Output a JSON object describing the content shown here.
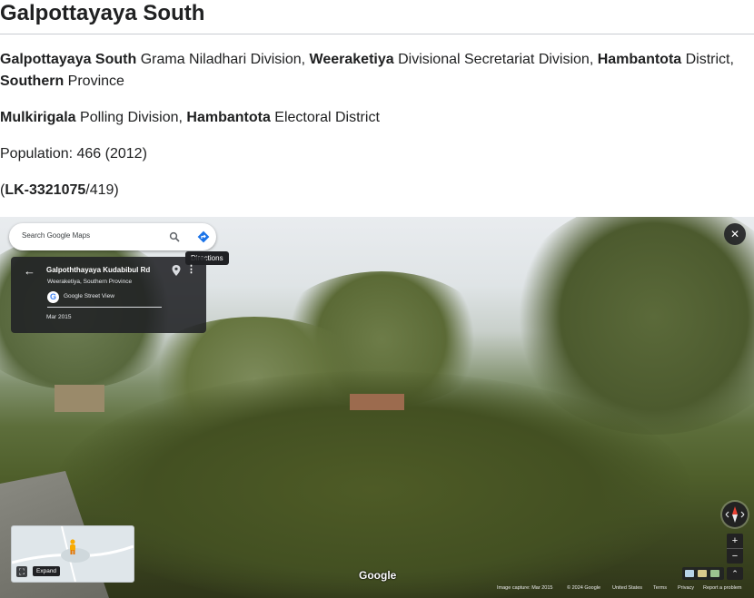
{
  "page": {
    "title": "Galpottayaya South"
  },
  "admin": {
    "gn_name": "Galpottayaya South",
    "gn_suffix": " Grama Niladhari Division, ",
    "ds_name": "Weeraketiya",
    "ds_suffix": " Divisional Secretariat Division, ",
    "district_name": "Hambantota",
    "district_suffix": " District,",
    "province_name": "Southern",
    "province_suffix": " Province"
  },
  "electoral": {
    "polling_name": "Mulkirigala",
    "polling_suffix": " Polling Division, ",
    "district_name": "Hambantota",
    "district_suffix": " Electoral District"
  },
  "population": {
    "text": "Population: 466 (2012)"
  },
  "code": {
    "open": "(",
    "id": "LK-3321075",
    "rest": "/419)"
  },
  "streetview": {
    "search_placeholder": "Search Google Maps",
    "directions_tooltip": "Directions",
    "place_title": "Galpoththayaya Kudabibul Rd",
    "place_subtitle": "Weeraketiya, Southern Province",
    "source_label": "Google Street View",
    "capture_date": "Mar 2015",
    "close_glyph": "✕",
    "zoom_in": "+",
    "zoom_out": "−",
    "expand_label": "Expand",
    "google_logo": "Google",
    "footer": {
      "capture": "Image capture: Mar 2015",
      "copyright": "© 2024 Google",
      "region": "United States",
      "terms": "Terms",
      "privacy": "Privacy",
      "report": "Report a problem"
    }
  },
  "icons": {
    "search": "search-icon",
    "directions": "directions-icon",
    "back": "back-arrow-icon",
    "pin": "map-pin-icon",
    "more": "more-vert-icon",
    "close": "close-icon",
    "compass": "compass-icon",
    "expand": "expand-icon",
    "pegman": "pegman-icon"
  },
  "colors": {
    "accent_blue": "#1a73e8",
    "compass_red": "#ea4335"
  }
}
